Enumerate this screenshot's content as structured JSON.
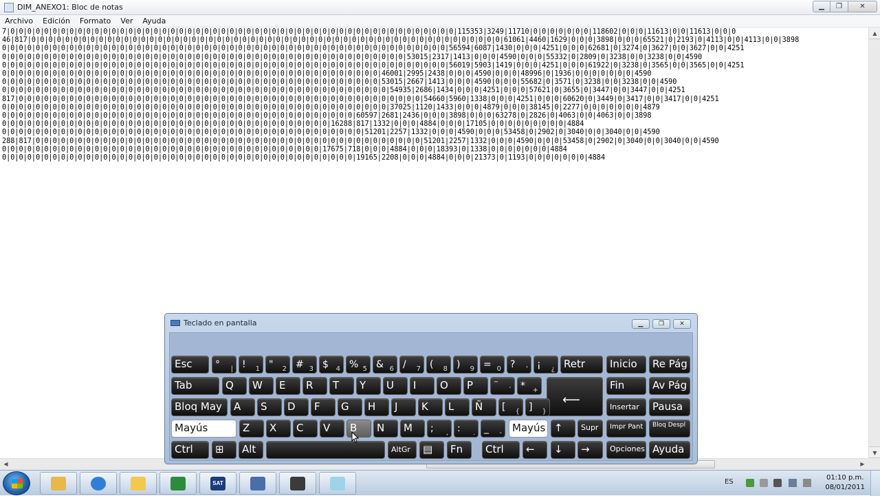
{
  "window": {
    "title": "DIM_ANEXO1: Bloc de notas",
    "minimize_label": "▁",
    "restore_label": "❐",
    "close_label": "✕"
  },
  "menu": [
    "Archivo",
    "Edición",
    "Formato",
    "Ver",
    "Ayuda"
  ],
  "editor": {
    "lines": [
      "7|0|0|0|0|0|0|0|0|0|0|0|0|0|0|0|0|0|0|0|0|0|0|0|0|0|0|0|0|0|0|0|0|0|0|0|0|0|0|0|0|0|0|0|0|0|0|0|0|0|0|0|0|0|115353|3249|11710|0|0|0|0|0|0|0|118602|0|0|0|11613|0|0|11613|0|0|0",
      "46|817|0|0|0|0|0|0|0|0|0|0|0|0|0|0|0|0|0|0|0|0|0|0|0|0|0|0|0|0|0|0|0|0|0|0|0|0|0|0|0|0|0|0|0|0|0|0|0|0|0|0|0|0|0|0|0|0|61061|4460|1629|0|0|0|3898|0|0|0|65521|0|2193|0|4113|0|0|4113|0|0|3898",
      "0|0|0|0|0|0|0|0|0|0|0|0|0|0|0|0|0|0|0|0|0|0|0|0|0|0|0|0|0|0|0|0|0|0|0|0|0|0|0|0|0|0|0|0|0|0|0|0|0|0|0|0|0|56594|6087|1430|0|0|0|4251|0|0|0|62681|0|3274|0|3627|0|0|3627|0|0|4251",
      "0|0|0|0|0|0|0|0|0|0|0|0|0|0|0|0|0|0|0|0|0|0|0|0|0|0|0|0|0|0|0|0|0|0|0|0|0|0|0|0|0|0|0|0|0|0|0|0|53015|2317|1413|0|0|0|4590|0|0|0|55332|0|2809|0|3238|0|0|3238|0|0|4590",
      "0|0|0|0|0|0|0|0|0|0|0|0|0|0|0|0|0|0|0|0|0|0|0|0|0|0|0|0|0|0|0|0|0|0|0|0|0|0|0|0|0|0|0|0|0|0|0|0|0|0|0|0|0|56019|5903|1419|0|0|0|4251|0|0|0|61922|0|3238|0|3565|0|0|3565|0|0|4251",
      "0|0|0|0|0|0|0|0|0|0|0|0|0|0|0|0|0|0|0|0|0|0|0|0|0|0|0|0|0|0|0|0|0|0|0|0|0|0|0|0|0|0|0|0|0|46001|2995|2438|0|0|0|4590|0|0|0|48996|0|1936|0|0|0|0|0|0|0|4590",
      "0|0|0|0|0|0|0|0|0|0|0|0|0|0|0|0|0|0|0|0|0|0|0|0|0|0|0|0|0|0|0|0|0|0|0|0|0|0|0|0|0|0|0|0|0|53015|2667|1413|0|0|0|4590|0|0|0|55682|0|3571|0|3238|0|0|3238|0|0|4590",
      "0|0|0|0|0|0|0|0|0|0|0|0|0|0|0|0|0|0|0|0|0|0|0|0|0|0|0|0|0|0|0|0|0|0|0|0|0|0|0|0|0|0|0|0|0|0|54935|2686|1434|0|0|0|4251|0|0|0|57621|0|3655|0|3447|0|0|3447|0|0|4251",
      "817|0|0|0|0|0|0|0|0|0|0|0|0|0|0|0|0|0|0|0|0|0|0|0|0|0|0|0|0|0|0|0|0|0|0|0|0|0|0|0|0|0|0|0|0|0|0|0|0|54660|5960|1338|0|0|0|4251|0|0|0|60620|0|3449|0|3417|0|0|3417|0|0|4251",
      "0|0|0|0|0|0|0|0|0|0|0|0|0|0|0|0|0|0|0|0|0|0|0|0|0|0|0|0|0|0|0|0|0|0|0|0|0|0|0|0|0|0|0|0|0|0|37025|1120|1433|0|0|0|4879|0|0|0|38145|0|2277|0|0|0|0|0|0|0|4879",
      "0|0|0|0|0|0|0|0|0|0|0|0|0|0|0|0|0|0|0|0|0|0|0|0|0|0|0|0|0|0|0|0|0|0|0|0|0|0|0|0|0|0|60597|2681|2436|0|0|0|3898|0|0|0|63278|0|2826|0|4063|0|0|4063|0|0|3898",
      "0|0|0|0|0|0|0|0|0|0|0|0|0|0|0|0|0|0|0|0|0|0|0|0|0|0|0|0|0|0|0|0|0|0|0|0|0|0|0|16288|817|1332|0|0|0|4884|0|0|0|17105|0|0|0|0|0|0|0|0|0|4884",
      "0|0|0|0|0|0|0|0|0|0|0|0|0|0|0|0|0|0|0|0|0|0|0|0|0|0|0|0|0|0|0|0|0|0|0|0|0|0|0|0|0|0|0|51201|2257|1332|0|0|0|4590|0|0|0|53458|0|2902|0|3040|0|0|3040|0|0|4590",
      "288|817|0|0|0|0|0|0|0|0|0|0|0|0|0|0|0|0|0|0|0|0|0|0|0|0|0|0|0|0|0|0|0|0|0|0|0|0|0|0|0|0|0|0|0|0|0|0|51201|2257|1332|0|0|0|4590|0|0|0|53458|0|2902|0|3040|0|0|3040|0|0|4590",
      "0|0|0|0|0|0|0|0|0|0|0|0|0|0|0|0|0|0|0|0|0|0|0|0|0|0|0|0|0|0|0|0|0|0|0|0|0|0|17675|718|0|0|0|4884|0|0|0|18393|0|1338|0|0|0|0|0|0|0|4884",
      "0|0|0|0|0|0|0|0|0|0|0|0|0|0|0|0|0|0|0|0|0|0|0|0|0|0|0|0|0|0|0|0|0|0|0|0|0|0|0|0|0|0|19165|2208|0|0|0|4884|0|0|0|21373|0|1193|0|0|0|0|0|0|0|4884"
    ]
  },
  "keyboard": {
    "title": "Teclado en pantalla",
    "keys": {
      "esc": "Esc",
      "k1": "!",
      "k1s": "1",
      "kdeg": "°",
      "kdegs": "|",
      "k2": "\"",
      "k2s": "2",
      "k3": "#",
      "k3s": "3",
      "k4": "$",
      "k4s": "4",
      "k5": "%",
      "k5s": "5",
      "k6": "&",
      "k6s": "6",
      "k7": "/",
      "k7s": "7",
      "k8": "(",
      "k8s": "8",
      "k9": ")",
      "k9s": "9",
      "k0": "=",
      "k0s": "0",
      "kq": "?",
      "kqs": "'",
      "ki": "¡",
      "kis": "¿",
      "retr": "Retr",
      "inicio": "Inicio",
      "repag": "Re Pág",
      "tab": "Tab",
      "Q": "Q",
      "W": "W",
      "E": "E",
      "R": "R",
      "T": "T",
      "Y": "Y",
      "U": "U",
      "I": "I",
      "O": "O",
      "P": "P",
      "acc": "¨",
      "accs": "´",
      "plus": "*",
      "pluss": "+",
      "fin": "Fin",
      "avpag": "Av Pág",
      "bloqmay": "Bloq May",
      "A": "A",
      "S": "S",
      "D": "D",
      "F": "F",
      "G": "G",
      "H": "H",
      "J": "J",
      "K": "K",
      "L": "L",
      "N_tilde": "Ñ",
      "brk1": "[",
      "brk1s": "{",
      "brk2": "]",
      "brk2s": "}",
      "insertar": "Insertar",
      "pausa": "Pausa",
      "mayus_l": "Mayús",
      "Z": "Z",
      "X": "X",
      "C": "C",
      "V": "V",
      "B": "B",
      "N": "N",
      "M": "M",
      "semi": ";",
      "semis": ",",
      "colon": ":",
      "colons": ".",
      "under": "_",
      "unders": "-",
      "mayus_r": "Mayús",
      "up": "↑",
      "supr": "Supr",
      "imprpant": "Impr Pant",
      "bloqdespl": "Bloq Despl",
      "ctrl_l": "Ctrl",
      "win": "⊞",
      "alt": "Alt",
      "altgr": "AltGr",
      "menu": "▤",
      "fn": "Fn",
      "ctrl_r": "Ctrl",
      "left": "←",
      "down": "↓",
      "right": "→",
      "opciones": "Opciones",
      "ayuda": "Ayuda",
      "enter": "⟵"
    }
  },
  "tray": {
    "lang": "ES",
    "time": "01:10 p.m.",
    "date": "08/01/2011",
    "sat_label": "SAT"
  }
}
